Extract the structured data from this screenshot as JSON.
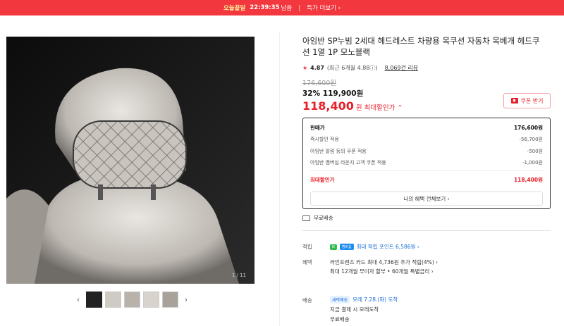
{
  "topbar": {
    "badge": "오늘끝딜",
    "timer": "22:39:35",
    "timer_suffix": "남음",
    "more": "특가 더보기 ›"
  },
  "gallery": {
    "counter": "1 / 11",
    "prev": "‹",
    "next": "›",
    "thumb_count": 5
  },
  "product": {
    "title": "아임반 SP누빔 2세대 헤드레스트 차량용 목쿠션 자동차 목베개 헤드쿠션 1열 1P 모노블랙",
    "rating": "4.87",
    "rating_sub": "(최근 6개월 4.88ⓘ)",
    "reviews": "8,069건 리뷰",
    "orig_price": "176,600원",
    "discount": "32% 119,900원",
    "max_price": "118,400",
    "max_price_unit": "원",
    "max_price_label": "최대할인가 ⌃",
    "coupon_btn": "쿠폰 받기"
  },
  "price_box": {
    "rows": [
      {
        "label": "판매가",
        "value": "176,600원"
      },
      {
        "label": "즉시할인 적용",
        "value": "-56,700원"
      },
      {
        "label": "아임반 알림 등의 쿠폰 적용",
        "value": "-500원"
      },
      {
        "label": "아임반 멤버십 라운지 고객 쿠폰 적용",
        "value": "-1,000원"
      }
    ],
    "total_label": "최대할인가",
    "total_value": "118,400원",
    "benefit_btn": "나의 혜택 전체보기 ›"
  },
  "shipping": {
    "free": "무료배송"
  },
  "info": {
    "points_label": "적립",
    "points_badge1": "N",
    "points_badge2": "멤버십",
    "points_value": "최대 적립 포인트 6,586원 ›",
    "benefit_label": "혜택",
    "benefit_line1": "라인프렌즈 카드 최대 4,736원 추가 적립(4%) ›",
    "benefit_line2": "최대 12개월 무이자 할부 • 60개월 특별금리 ›",
    "delivery_label": "배송",
    "delivery_badge": "새벽배송",
    "delivery_value": "모레 7.28.(화) 도착",
    "delivery_line2": "지금 결제 시 모레도착",
    "delivery_line3": "무료배송"
  }
}
